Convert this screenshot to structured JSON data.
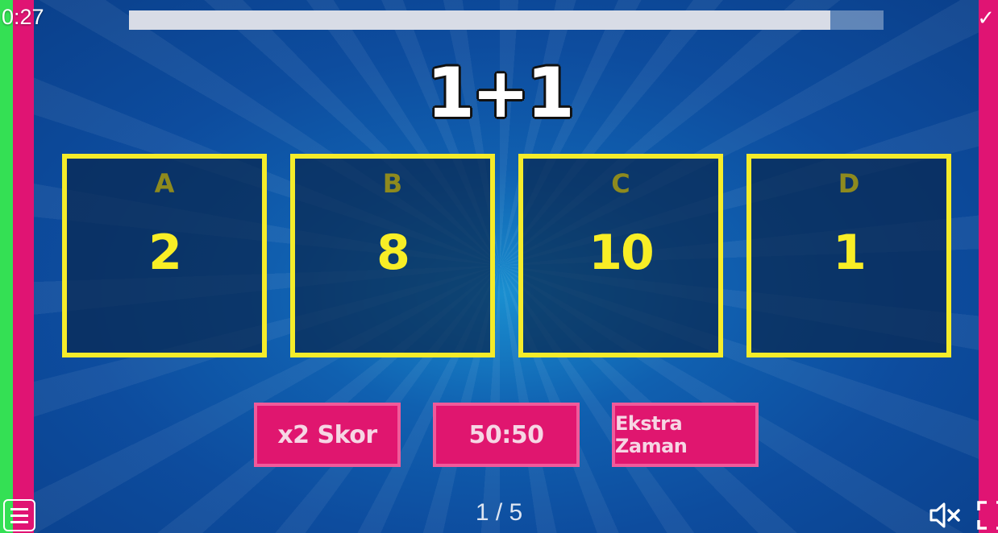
{
  "hud": {
    "timer": "0:27",
    "progress_fraction": 0.93,
    "correct_icon": "checkmark-icon"
  },
  "question": {
    "text": "1+1"
  },
  "answers": [
    {
      "letter": "A",
      "value": "2"
    },
    {
      "letter": "B",
      "value": "8"
    },
    {
      "letter": "C",
      "value": "10"
    },
    {
      "letter": "D",
      "value": "1"
    }
  ],
  "powerups": {
    "double_score": "x2 Skor",
    "fifty_fifty": "50:50",
    "extra_time": "Ekstra Zaman"
  },
  "footer": {
    "page": "1 / 5",
    "menu_icon": "menu-icon",
    "mute_icon": "speaker-muted-icon",
    "fullscreen_icon": "fullscreen-icon"
  },
  "colors": {
    "answer_border": "#f5ec2a",
    "answer_value": "#f8ee26",
    "answer_letter": "#8e8a1e",
    "powerup_bg": "#e0166f",
    "side_pink": "#e01473",
    "side_green": "#34e054",
    "background": "#0d4c9e"
  }
}
